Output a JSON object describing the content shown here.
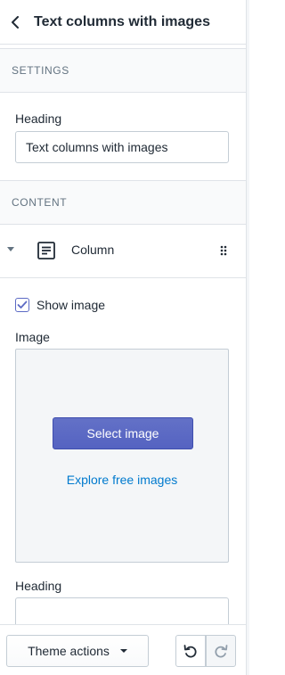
{
  "header": {
    "title": "Text columns with images",
    "back_icon": "chevron-left-icon"
  },
  "settings_section": {
    "label": "SETTINGS"
  },
  "settings": {
    "heading_label": "Heading",
    "heading_value": "Text columns with images"
  },
  "content_section": {
    "label": "CONTENT"
  },
  "block": {
    "label": "Column",
    "icon": "text-block-icon",
    "expanded": true
  },
  "block_settings": {
    "show_image_label": "Show image",
    "show_image_checked": true,
    "image_label": "Image",
    "select_image_label": "Select image",
    "explore_images_label": "Explore free images",
    "heading_label": "Heading",
    "heading_value": ""
  },
  "footer": {
    "theme_actions_label": "Theme actions",
    "undo_icon": "undo-icon",
    "redo_icon": "redo-icon"
  },
  "colors": {
    "primary": "#5c6ac4",
    "link": "#007ace",
    "border": "#c4cdd5",
    "text": "#212b36",
    "muted": "#637381"
  }
}
